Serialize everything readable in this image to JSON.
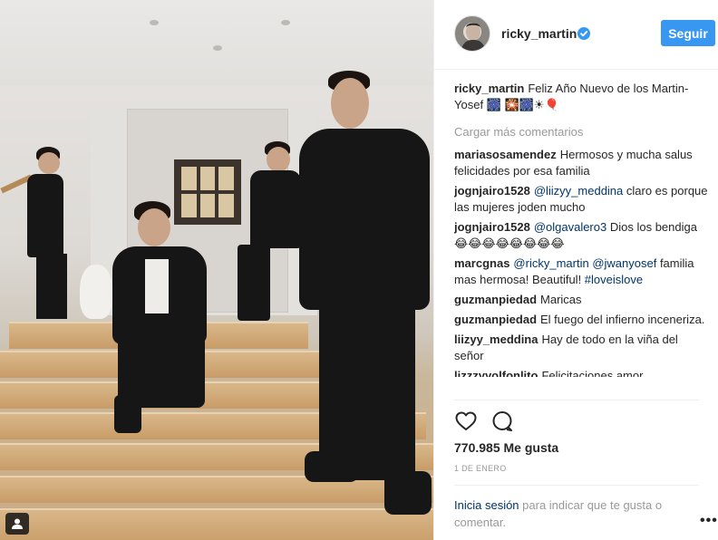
{
  "post": {
    "username": "ricky_martin",
    "follow_label": "Seguir",
    "caption_user": "ricky_martin",
    "caption_text": "Feliz Año Nuevo de los Martin-Yosef 🎆 🎇🎆☀🎈",
    "load_more": "Cargar más comentarios",
    "likes": "770.985 Me gusta",
    "date": "1 DE ENERO",
    "login_link": "Inicia sesión",
    "login_text": " para indicar que te gusta o comentar.",
    "more_options": "•••"
  },
  "comments": [
    {
      "user": "mariasosamendez",
      "parts": [
        {
          "t": "Hermosos y mucha salus felicidades por esa familia",
          "link": false
        }
      ]
    },
    {
      "user": "jognjairo1528",
      "parts": [
        {
          "t": "@liizyy_meddina",
          "link": true
        },
        {
          "t": " claro es porque las mujeres joden mucho",
          "link": false
        }
      ]
    },
    {
      "user": "jognjairo1528",
      "parts": [
        {
          "t": "@olgavalero3",
          "link": true
        },
        {
          "t": " Dios los bendiga 😂😂😂😂😂😂😂😂",
          "link": false
        }
      ]
    },
    {
      "user": "marcgnas",
      "parts": [
        {
          "t": "@ricky_martin",
          "link": true
        },
        {
          "t": " ",
          "link": false
        },
        {
          "t": "@jwanyosef",
          "link": true
        },
        {
          "t": " familia mas hermosa! Beautiful! ",
          "link": false
        },
        {
          "t": "#loveislove",
          "link": true
        }
      ]
    },
    {
      "user": "guzmanpiedad",
      "parts": [
        {
          "t": "Maricas",
          "link": false
        }
      ]
    },
    {
      "user": "guzmanpiedad",
      "parts": [
        {
          "t": "El fuego del infierno inceneriza.",
          "link": false
        }
      ]
    },
    {
      "user": "liizyy_meddina",
      "parts": [
        {
          "t": "Hay de todo en la viña del señor",
          "link": false
        }
      ]
    },
    {
      "user": "lizzzyyolfonlito",
      "parts": [
        {
          "t": "Felicitaciones amor",
          "link": false
        }
      ]
    }
  ],
  "icons": {
    "verified": "verified-badge-icon",
    "like": "heart-icon",
    "comment": "comment-bubble-icon",
    "user_tag": "user-tag-icon"
  },
  "colors": {
    "accent": "#3897f0",
    "link": "#003569",
    "muted": "#999999",
    "text": "#262626"
  }
}
